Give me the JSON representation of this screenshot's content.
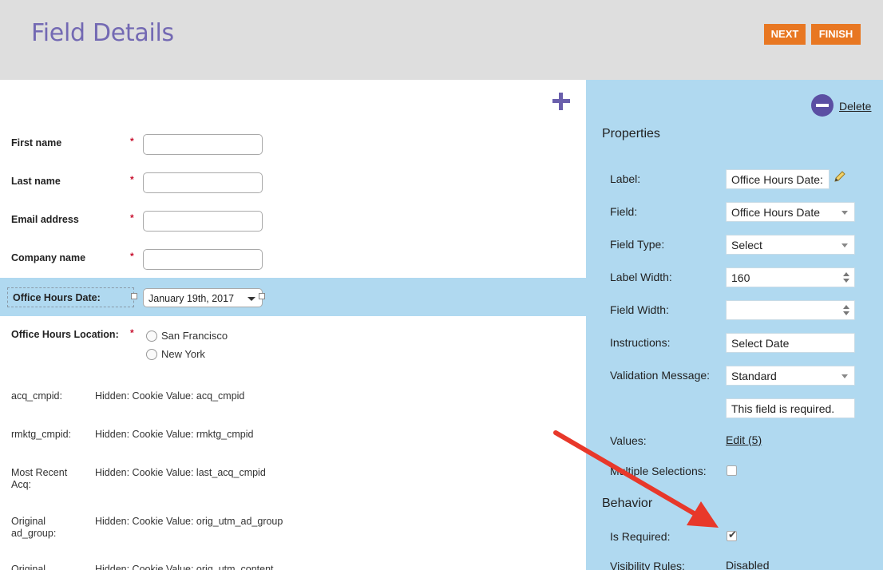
{
  "header": {
    "title": "Field Details",
    "next_label": "NEXT",
    "finish_label": "FINISH",
    "accent_color": "#e87722",
    "title_color": "#7369b3"
  },
  "form": {
    "fields": [
      {
        "label": "First name",
        "required": "*"
      },
      {
        "label": "Last name",
        "required": "*"
      },
      {
        "label": "Email address",
        "required": "*"
      },
      {
        "label": "Company name",
        "required": "*"
      }
    ],
    "selected_field": {
      "label": "Office Hours Date:",
      "value": "January 19th, 2017"
    },
    "location": {
      "label": "Office Hours Location:",
      "required": "*",
      "options": [
        "San Francisco",
        "New York"
      ]
    },
    "hidden_fields": [
      {
        "label": "acq_cmpid:",
        "value": "Hidden: Cookie Value: acq_cmpid"
      },
      {
        "label": "rmktg_cmpid:",
        "value": "Hidden: Cookie Value: rmktg_cmpid"
      },
      {
        "label": "Most Recent Acq:",
        "value": "Hidden: Cookie Value: last_acq_cmpid"
      },
      {
        "label": "Original ad_group:",
        "value": "Hidden: Cookie Value: orig_utm_ad_group"
      },
      {
        "label": "Original",
        "value": "Hidden: Cookie Value: orig_utm_content"
      }
    ],
    "add_icon": "plus-icon"
  },
  "panel": {
    "delete_label": "Delete",
    "properties_title": "Properties",
    "label_label": "Label:",
    "label_value": "Office Hours Date:",
    "field_label": "Field:",
    "field_value": "Office Hours Date",
    "field_type_label": "Field Type:",
    "field_type_value": "Select",
    "label_width_label": "Label Width:",
    "label_width_value": "160",
    "field_width_label": "Field Width:",
    "field_width_value": "",
    "instructions_label": "Instructions:",
    "instructions_value": "Select Date",
    "validation_label": "Validation Message:",
    "validation_value": "Standard",
    "validation_text": "This field is required.",
    "values_label": "Values:",
    "values_link": "Edit (5)",
    "multiple_label": "Multiple Selections:",
    "multiple_checked": false,
    "behavior_title": "Behavior",
    "required_label": "Is Required:",
    "required_checked": true,
    "visibility_label": "Visibility Rules:",
    "visibility_value": "Disabled",
    "panel_color": "#b0d9f0"
  },
  "annotation": {
    "arrow_color": "#e8382a"
  }
}
